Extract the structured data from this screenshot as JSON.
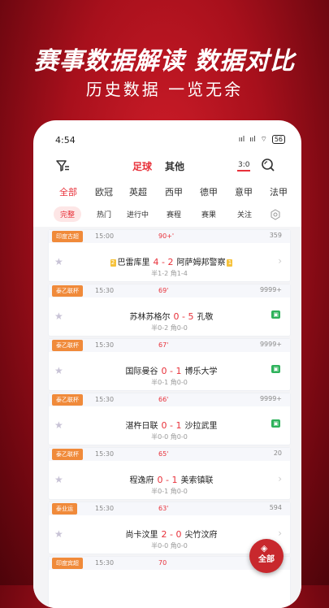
{
  "promo": {
    "title": "赛事数据解读  数据对比",
    "subtitle": "历史数据 一览无余"
  },
  "status_bar": {
    "time": "4:54",
    "signal1": "ııl",
    "signal2": "ııl",
    "wifi": "⌔",
    "battery": "56"
  },
  "topbar": {
    "tab_football": "足球",
    "tab_other": "其他",
    "score_icon": "3:0"
  },
  "league_tabs": [
    "全部",
    "欧冠",
    "英超",
    "西甲",
    "德甲",
    "意甲",
    "法甲"
  ],
  "status_tabs": [
    "完整",
    "热门",
    "进行中",
    "赛程",
    "赛果",
    "关注"
  ],
  "matches": [
    {
      "league": "印度古超",
      "time": "15:00",
      "minute": "90+'",
      "heat": "359",
      "home": "巴雷库里",
      "home_card": "2",
      "score": "4 - 2",
      "away": "阿萨姆邦警察",
      "away_card": "1",
      "extra": "半1-2 角1-4",
      "end": "chevron"
    },
    {
      "league": "泰乙联杯",
      "time": "15:30",
      "minute": "69'",
      "heat": "9999+",
      "home": "苏林苏格尔",
      "home_card": "",
      "score": "0 - 5",
      "away": "孔敬",
      "away_card": "",
      "extra": "半0-2 角0-0",
      "end": "live"
    },
    {
      "league": "泰乙联杯",
      "time": "15:30",
      "minute": "67'",
      "heat": "9999+",
      "home": "国际曼谷",
      "home_card": "",
      "score": "0 - 1",
      "away": "博乐大学",
      "away_card": "",
      "extra": "半0-1 角0-0",
      "end": "live"
    },
    {
      "league": "泰乙联杯",
      "time": "15:30",
      "minute": "66'",
      "heat": "9999+",
      "home": "湛杵日联",
      "home_card": "",
      "score": "0 - 1",
      "away": "沙拉武里",
      "away_card": "",
      "extra": "半0-0 角0-0",
      "end": "live"
    },
    {
      "league": "泰乙联杯",
      "time": "15:30",
      "minute": "65'",
      "heat": "20",
      "home": "程逸府",
      "home_card": "",
      "score": "0 - 1",
      "away": "美索镇联",
      "away_card": "",
      "extra": "半0-1 角0-0",
      "end": "chevron"
    },
    {
      "league": "泰业运",
      "time": "15:30",
      "minute": "63'",
      "heat": "594",
      "home": "尚卡汶里",
      "home_card": "",
      "score": "2 - 0",
      "away": "尖竹汶府",
      "away_card": "",
      "extra": "半0-0 角0-0",
      "end": "chevron"
    },
    {
      "league": "印度宾超",
      "time": "15:30",
      "minute": "70",
      "heat": "",
      "home": "",
      "home_card": "",
      "score": "",
      "away": "",
      "away_card": "",
      "extra": "",
      "end": ""
    }
  ],
  "float_button": "全部",
  "colors": {
    "accent": "#e8313a",
    "league_badge": "#f08a3a",
    "live": "#2eb25b",
    "bg_red": "#a8101c"
  }
}
